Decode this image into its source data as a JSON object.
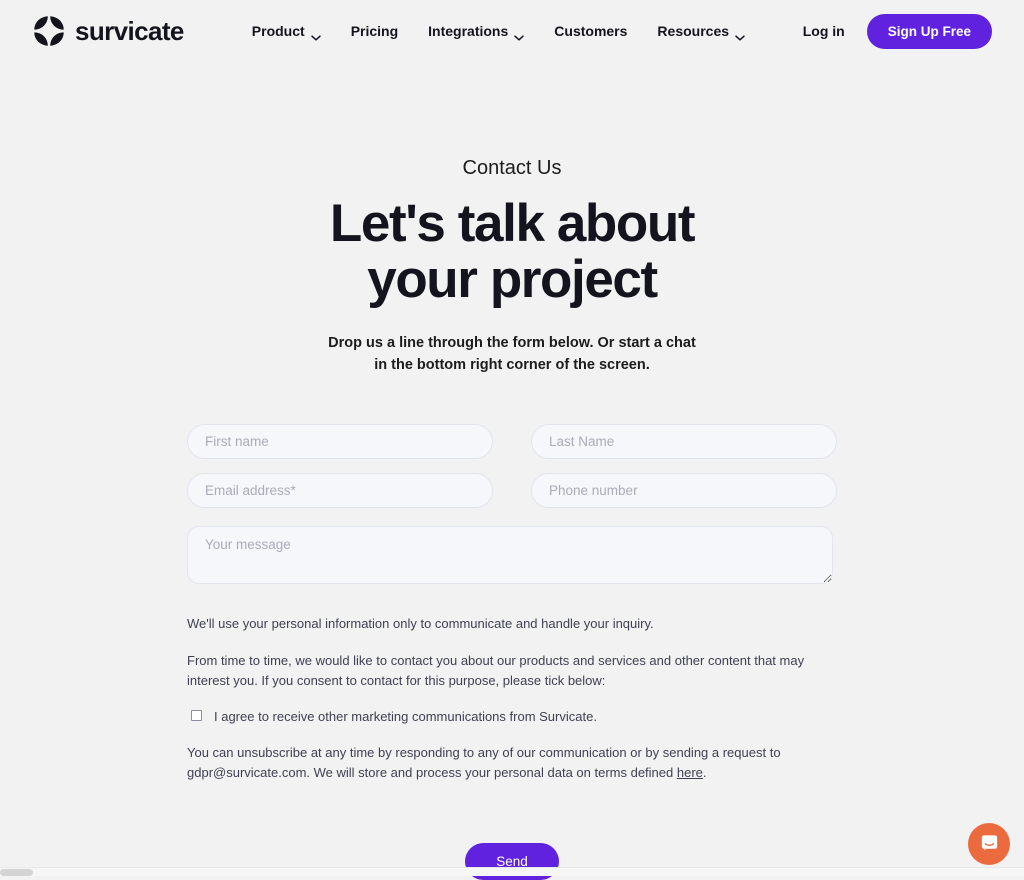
{
  "colors": {
    "background": "#f2f2f2",
    "accent_purple": "#6122e0",
    "text_dark": "#14141e",
    "text_body": "#3f4152",
    "placeholder": "#a9acb8",
    "field_fill": "#f6f7fb",
    "field_border": "#e3e5ee",
    "chat_orange": "#ec6b3e"
  },
  "header": {
    "logo": {
      "icon": "survicate-pinwheel-logo-icon",
      "text": "survicate"
    },
    "nav": [
      {
        "label": "Product",
        "has_dropdown": true,
        "icon": "chevron-down-icon"
      },
      {
        "label": "Pricing",
        "has_dropdown": false,
        "icon": ""
      },
      {
        "label": "Integrations",
        "has_dropdown": true,
        "icon": "chevron-down-icon"
      },
      {
        "label": "Customers",
        "has_dropdown": false,
        "icon": ""
      },
      {
        "label": "Resources",
        "has_dropdown": true,
        "icon": "chevron-down-icon"
      }
    ],
    "login_label": "Log in",
    "signup_label": "Sign Up Free"
  },
  "hero": {
    "eyebrow": "Contact Us",
    "title_line1": "Let's talk about",
    "title_line2": "your project",
    "subtitle": "Drop us a line through the form below. Or start a chat in the bottom right corner of the screen."
  },
  "form": {
    "first_name": {
      "placeholder": "First name",
      "value": ""
    },
    "last_name": {
      "placeholder": "Last Name",
      "value": ""
    },
    "email": {
      "placeholder": "Email address*",
      "value": ""
    },
    "phone": {
      "placeholder": "Phone number",
      "value": ""
    },
    "message": {
      "placeholder": "Your message",
      "value": ""
    },
    "submit_label": "Send"
  },
  "legal": {
    "paragraph1": "We'll use your personal information only to communicate and handle your inquiry.",
    "paragraph2": "From time to time, we would like to contact you about our products and services and other content that may interest you. If you consent to contact for this purpose, please tick below:",
    "consent_label": "I agree to receive other marketing communications from Survicate.",
    "consent_checked": false,
    "unsubscribe_pre": "You can unsubscribe at any time by responding to any of our communication or by sending a request to gdpr@survicate.com. We will store and process your personal data on terms defined ",
    "unsubscribe_link": "here",
    "unsubscribe_post": "."
  },
  "chat_widget": {
    "icon": "chat-bubble-icon",
    "label": "Open chat"
  }
}
